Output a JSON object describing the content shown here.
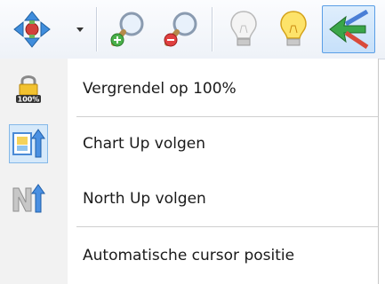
{
  "menu": {
    "items": [
      {
        "label": "Vergrendel op 100%",
        "icon": "padlock-100-icon",
        "icon_text": "100%",
        "checked": false
      },
      {
        "label": "Chart Up volgen",
        "icon": "chart-up-icon",
        "checked": true
      },
      {
        "label": "North Up volgen",
        "icon": "north-up-icon",
        "checked": false
      },
      {
        "label": "Automatische cursor positie",
        "icon": "",
        "checked": false
      }
    ]
  },
  "toolbar": {
    "buttons": [
      "pan-icon",
      "zoom-in-icon",
      "zoom-out-icon",
      "lightbulb-off-icon",
      "lightbulb-on-icon",
      "route-arrows-icon"
    ]
  },
  "colors": {
    "accent": "#4a9ae6",
    "checked_bg": "#d6e9fa"
  }
}
